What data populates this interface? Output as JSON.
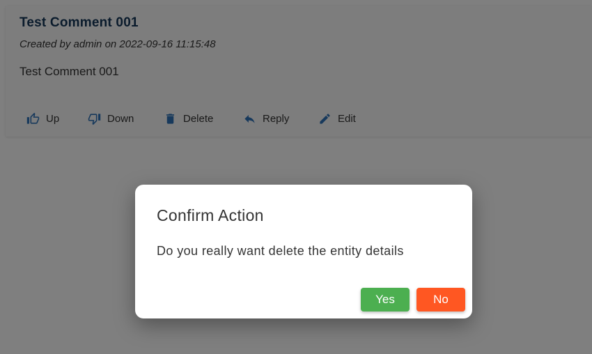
{
  "comment": {
    "title": "Test Comment 001",
    "meta": "Created by admin on 2022-09-16 11:15:48",
    "body": "Test Comment 001",
    "actions": [
      {
        "label": "Up",
        "icon": "thumbs-up-icon"
      },
      {
        "label": "Down",
        "icon": "thumbs-down-icon"
      },
      {
        "label": "Delete",
        "icon": "trash-icon"
      },
      {
        "label": "Reply",
        "icon": "reply-icon"
      },
      {
        "label": "Edit",
        "icon": "pencil-icon"
      }
    ]
  },
  "dialog": {
    "title": "Confirm Action",
    "message": "Do you really want delete the entity details",
    "yes_label": "Yes",
    "no_label": "No"
  },
  "colors": {
    "accent_icon": "#2e73b9",
    "title": "#143659",
    "yes_button": "#4caf50",
    "no_button": "#ff5722",
    "overlay": "rgba(0,0,0,0.5)"
  }
}
